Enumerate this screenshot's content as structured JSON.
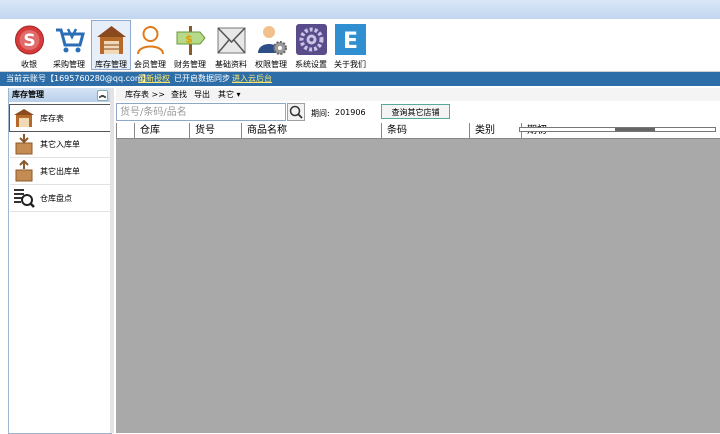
{
  "toolbar": {
    "items": [
      {
        "label": "收银",
        "icon": "cashier-icon"
      },
      {
        "label": "采购管理",
        "icon": "cart-icon"
      },
      {
        "label": "库存管理",
        "icon": "warehouse-icon"
      },
      {
        "label": "会员管理",
        "icon": "person-icon"
      },
      {
        "label": "财务管理",
        "icon": "money-sign-icon"
      },
      {
        "label": "基础资料",
        "icon": "envelope-icon"
      },
      {
        "label": "权限管理",
        "icon": "user-gear-icon"
      },
      {
        "label": "系统设置",
        "icon": "settings-icon"
      },
      {
        "label": "关于我们",
        "icon": "letter-e-icon"
      }
    ],
    "active_index": 2
  },
  "status": {
    "account": "当前云账号【1695760280@qq.com】",
    "reauth": "重新授权",
    "sync": "已开启数据同步",
    "cloud": "进入云后台"
  },
  "sidebar": {
    "title": "库存管理",
    "items": [
      {
        "label": "库存表"
      },
      {
        "label": "其它入库单"
      },
      {
        "label": "其它出库单"
      },
      {
        "label": "仓库盘点"
      }
    ]
  },
  "menu": {
    "breadcrumb": "库存表 >>",
    "find": "查找",
    "export": "导出",
    "other": "其它 ▾"
  },
  "filter": {
    "search_placeholder": "货号/条码/品名",
    "period_label": "期间:",
    "period_value": "201906",
    "query_button": "查询其它店铺"
  },
  "grid": {
    "columns": [
      "仓库",
      "货号",
      "商品名称",
      "条码",
      "类别",
      "期初"
    ]
  },
  "colors": {
    "status_bar": "#2d6ea8",
    "grid_background": "#a9a9a9"
  }
}
